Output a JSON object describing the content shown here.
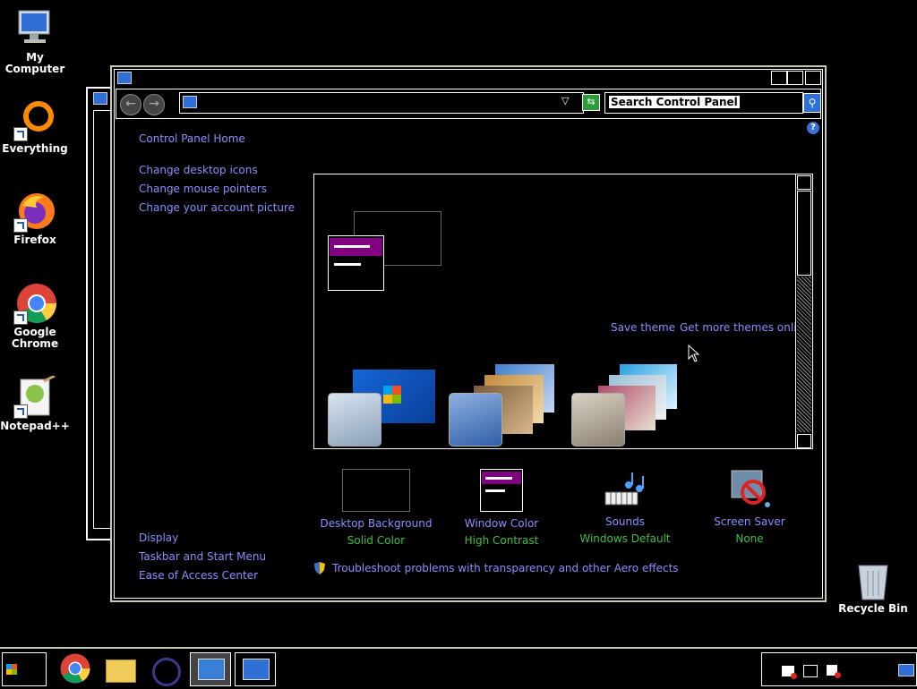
{
  "desktop": {
    "icons": [
      {
        "label": "My Computer"
      },
      {
        "label": "Everything"
      },
      {
        "label": "Firefox"
      },
      {
        "label": "Google Chrome"
      },
      {
        "label": "Notepad++"
      },
      {
        "label": "Recycle Bin"
      }
    ]
  },
  "window": {
    "search_placeholder": "Search Control Panel",
    "sidebar": {
      "home": "Control Panel Home",
      "links": [
        "Change desktop icons",
        "Change mouse pointers",
        "Change your account picture"
      ],
      "see_also": [
        "Display",
        "Taskbar and Start Menu",
        "Ease of Access Center"
      ]
    },
    "theme_links": {
      "save": "Save theme",
      "more": "Get more themes online"
    },
    "bottom_items": [
      {
        "label": "Desktop Background",
        "value": "Solid Color"
      },
      {
        "label": "Window Color",
        "value": "High Contrast"
      },
      {
        "label": "Sounds",
        "value": "Windows Default"
      },
      {
        "label": "Screen Saver",
        "value": "None"
      }
    ],
    "troubleshoot": "Troubleshoot problems with transparency and other Aero effects"
  },
  "colors": {
    "link": "#8d8dff",
    "subvalue": "#3fbf3f",
    "selection": "#800080",
    "frame": "#c9c9b0"
  }
}
